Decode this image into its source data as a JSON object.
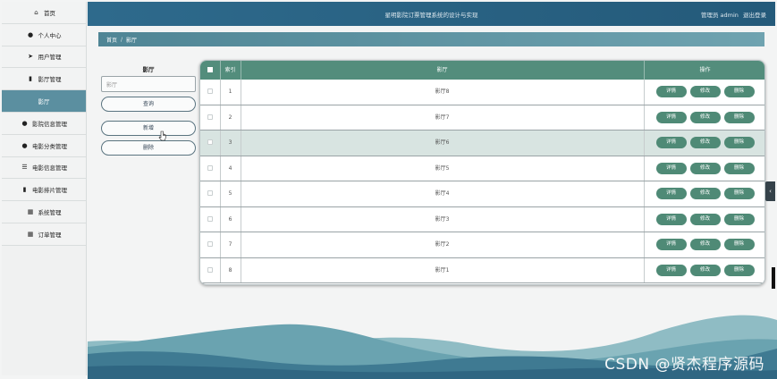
{
  "header": {
    "title": "星明影院订票管理系统的设计与实现",
    "user_label": "管理员 admin",
    "logout": "退出登录"
  },
  "sidebar": {
    "items": [
      {
        "label": "首页",
        "icon": "home-icon",
        "glyph": "⌂"
      },
      {
        "label": "个人中心",
        "icon": "user-icon",
        "glyph": "●"
      },
      {
        "label": "用户管理",
        "icon": "send-icon",
        "glyph": "➤"
      },
      {
        "label": "影厅管理",
        "icon": "trash-icon",
        "glyph": "▮"
      },
      {
        "label": "影厅",
        "icon": "",
        "glyph": ""
      },
      {
        "label": "影院信息管理",
        "icon": "user-icon",
        "glyph": "●"
      },
      {
        "label": "电影分类管理",
        "icon": "user-icon",
        "glyph": "●"
      },
      {
        "label": "电影信息管理",
        "icon": "sliders-icon",
        "glyph": "☰"
      },
      {
        "label": "电影排片管理",
        "icon": "bar-chart-icon",
        "glyph": "▮"
      },
      {
        "label": "系统管理",
        "icon": "grid-icon",
        "glyph": "▦"
      },
      {
        "label": "订单管理",
        "icon": "grid-icon",
        "glyph": "▦"
      }
    ],
    "active_index": 4
  },
  "breadcrumb": {
    "home": "首页",
    "separator": "/",
    "current": "影厅"
  },
  "search": {
    "label": "影厅",
    "placeholder": "影厅",
    "query_button": "查询",
    "add_button": "新增",
    "delete_button": "删除"
  },
  "table": {
    "headers": {
      "index": "索引",
      "name": "影厅",
      "actions": "操作"
    },
    "action_labels": {
      "detail": "详情",
      "edit": "修改",
      "delete": "删除"
    },
    "rows": [
      {
        "index": "1",
        "name": "影厅8"
      },
      {
        "index": "2",
        "name": "影厅7"
      },
      {
        "index": "3",
        "name": "影厅6"
      },
      {
        "index": "4",
        "name": "影厅5"
      },
      {
        "index": "5",
        "name": "影厅4"
      },
      {
        "index": "6",
        "name": "影厅3"
      },
      {
        "index": "7",
        "name": "影厅2"
      },
      {
        "index": "8",
        "name": "影厅1"
      }
    ],
    "highlighted_row": 2
  },
  "watermark": "CSDN @贤杰程序源码",
  "colors": {
    "header_bg": "#2e6a8c",
    "table_head": "#538d7c",
    "action_btn": "#4f8a76",
    "active_sidebar": "#5b8fa0"
  }
}
